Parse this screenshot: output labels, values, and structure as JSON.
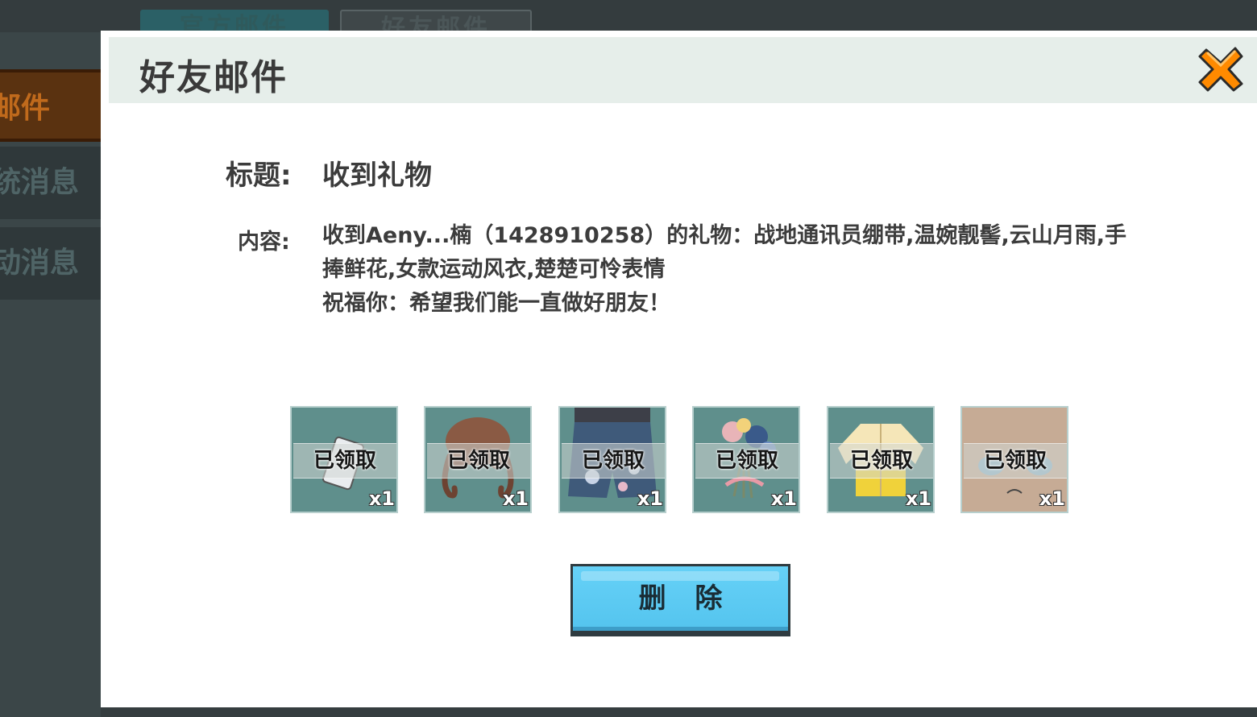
{
  "background": {
    "tabs": [
      "官方邮件",
      "好友邮件"
    ],
    "sidebar": [
      "邮件",
      "统消息",
      "动消息"
    ]
  },
  "modal": {
    "title": "好友邮件",
    "close_icon": "close-x-icon",
    "subject_label": "标题:",
    "subject_value": "收到礼物",
    "content_label": "内容:",
    "content_lines": [
      "收到Aeny...楠（1428910258）的礼物：战地通讯员绷带,温婉靓髻,云山月雨,手",
      "捧鲜花,女款运动风衣,楚楚可怜表情",
      "祝福你：希望我们能一直做好朋友！"
    ],
    "items": [
      {
        "icon": "bandage-icon",
        "status": "已领取",
        "qty": "x1"
      },
      {
        "icon": "hair-bun-icon",
        "status": "已领取",
        "qty": "x1"
      },
      {
        "icon": "cloud-shorts-icon",
        "status": "已领取",
        "qty": "x1"
      },
      {
        "icon": "flower-bouquet-icon",
        "status": "已领取",
        "qty": "x1"
      },
      {
        "icon": "sport-jacket-icon",
        "status": "已领取",
        "qty": "x1"
      },
      {
        "icon": "pitiful-face-icon",
        "status": "已领取",
        "qty": "x1"
      }
    ],
    "delete_label": "删 除"
  },
  "colors": {
    "header_bg": "#e6eeea",
    "item_bg": "#5f8f8c",
    "delete_button": "#5ccbf4",
    "close_orange": "#ff8a00"
  }
}
